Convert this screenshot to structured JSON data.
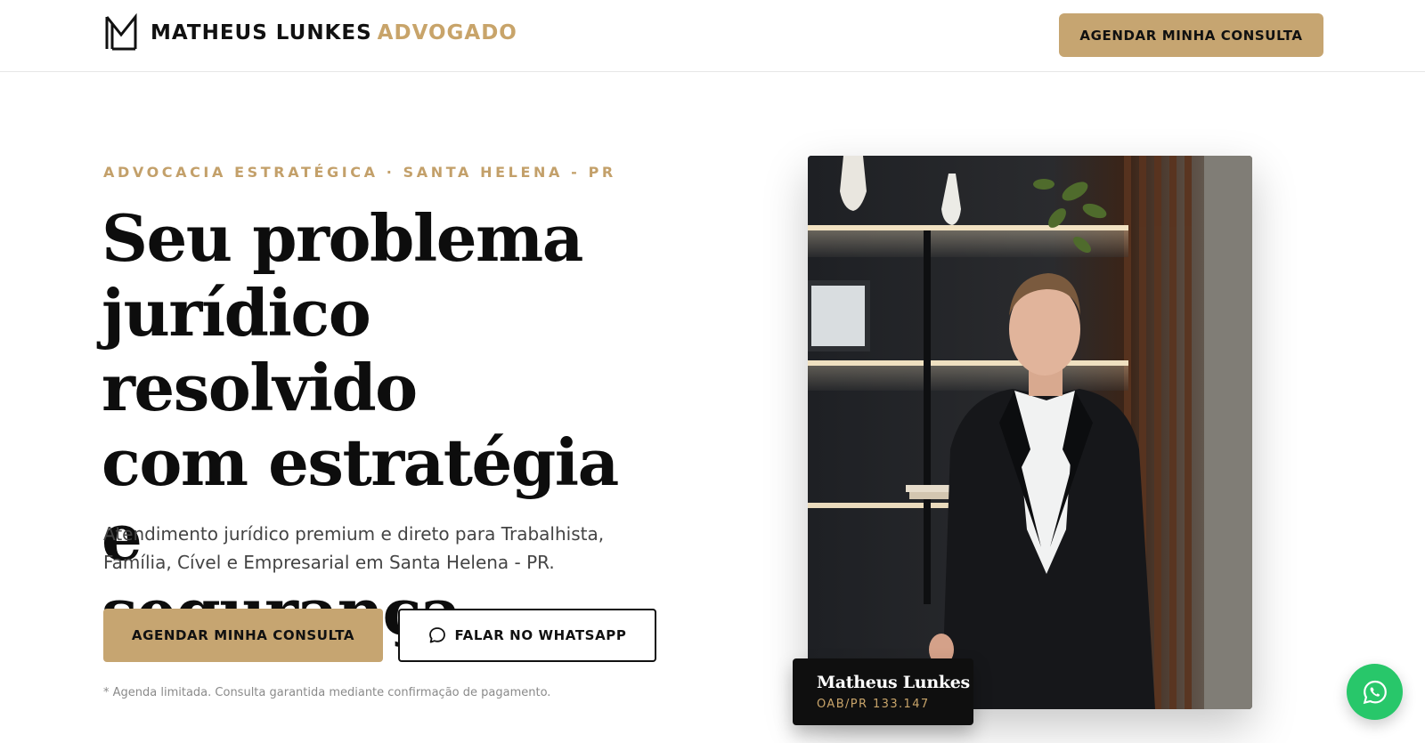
{
  "header": {
    "brand_name": "MATHEUS LUNKES",
    "brand_accent": "ADVOGADO",
    "cta_label": "AGENDAR MINHA CONSULTA"
  },
  "hero": {
    "eyebrow": "ADVOCACIA ESTRATÉGICA · SANTA HELENA - PR",
    "headline_lines": [
      "Seu problema",
      "jurídico resolvido",
      "com estratégia e",
      "segurança"
    ],
    "subtext": "Atendimento jurídico premium e direto para Trabalhista, Família, Cível e Empresarial em Santa Helena - PR.",
    "primary_button": "AGENDAR MINHA CONSULTA",
    "secondary_button": "FALAR NO WHATSAPP",
    "secondary_icon": "chat-bubble-icon",
    "disclaimer": "* Agenda limitada. Consulta garantida mediante confirmação de pagamento."
  },
  "profile_card": {
    "name": "Matheus Lunkes",
    "registration": "OAB/PR 133.147"
  },
  "floating": {
    "icon": "whatsapp-icon"
  },
  "colors": {
    "accent": "#c6a571",
    "accent_text": "#c3a06a",
    "dark": "#0f0f0f",
    "whatsapp": "#28c76a"
  }
}
